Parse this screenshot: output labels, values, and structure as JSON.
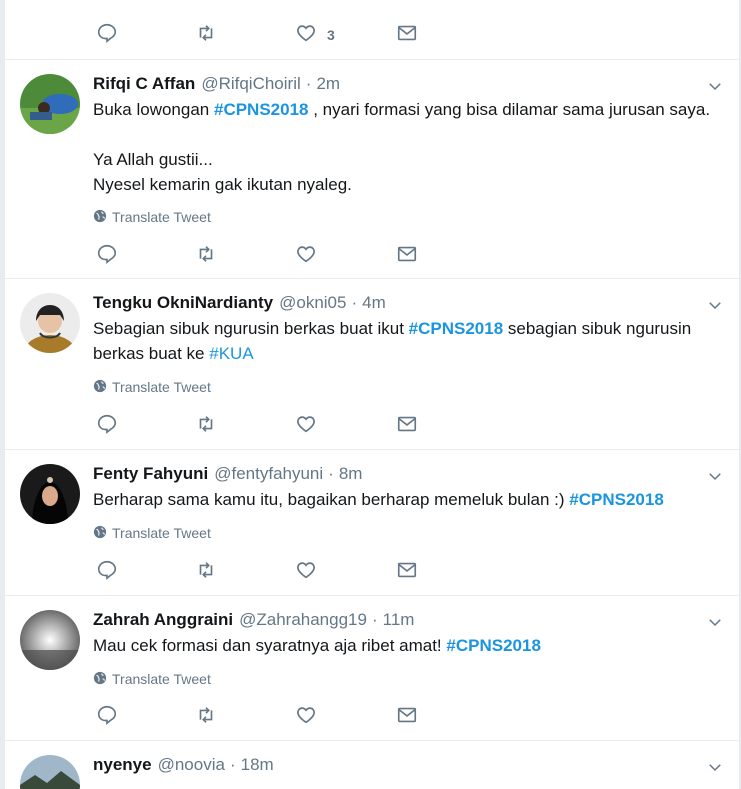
{
  "top_actions": {
    "like_count": "3"
  },
  "tweets": [
    {
      "name": "Rifqi C Affan",
      "handle": "@RifqiChoiril",
      "time": "2m",
      "text_before": "Buka lowongan ",
      "hashtag1": "#CPNS2018",
      "text_after": " , nyari formasi yang bisa dilamar sama jurusan saya.",
      "line2": "Ya Allah gustii...",
      "line3": "Nyesel kemarin gak ikutan nyaleg.",
      "translate": "Translate Tweet"
    },
    {
      "name": "Tengku OkniNardianty",
      "handle": "@okni05",
      "time": "4m",
      "text1": "Sebagian sibuk ngurusin berkas buat ikut ",
      "hashtag1": "#CPNS2018",
      "text2": " sebagian sibuk ngurusin berkas buat ke ",
      "hashtag2": "#KUA",
      "translate": "Translate Tweet"
    },
    {
      "name": "Fenty Fahyuni",
      "handle": "@fentyfahyuni",
      "time": "8m",
      "text1": "Berharap sama kamu itu, bagaikan berharap memeluk bulan :) ",
      "hashtag1": "#CPNS2018",
      "translate": "Translate Tweet"
    },
    {
      "name": "Zahrah Anggraini",
      "handle": "@Zahrahangg19",
      "time": "11m",
      "text1": "Mau cek formasi dan syaratnya aja ribet amat! ",
      "hashtag1": "#CPNS2018",
      "translate": "Translate Tweet"
    },
    {
      "name": "nyenye",
      "handle": "@noovia",
      "time": "18m"
    }
  ],
  "colors": {
    "accent": "#1b95e0",
    "muted": "#657786",
    "text": "#14171a",
    "divider": "#e6ecf0"
  },
  "icons": [
    "reply-icon",
    "retweet-icon",
    "like-icon",
    "message-icon",
    "globe-icon",
    "chevron-down-icon"
  ]
}
